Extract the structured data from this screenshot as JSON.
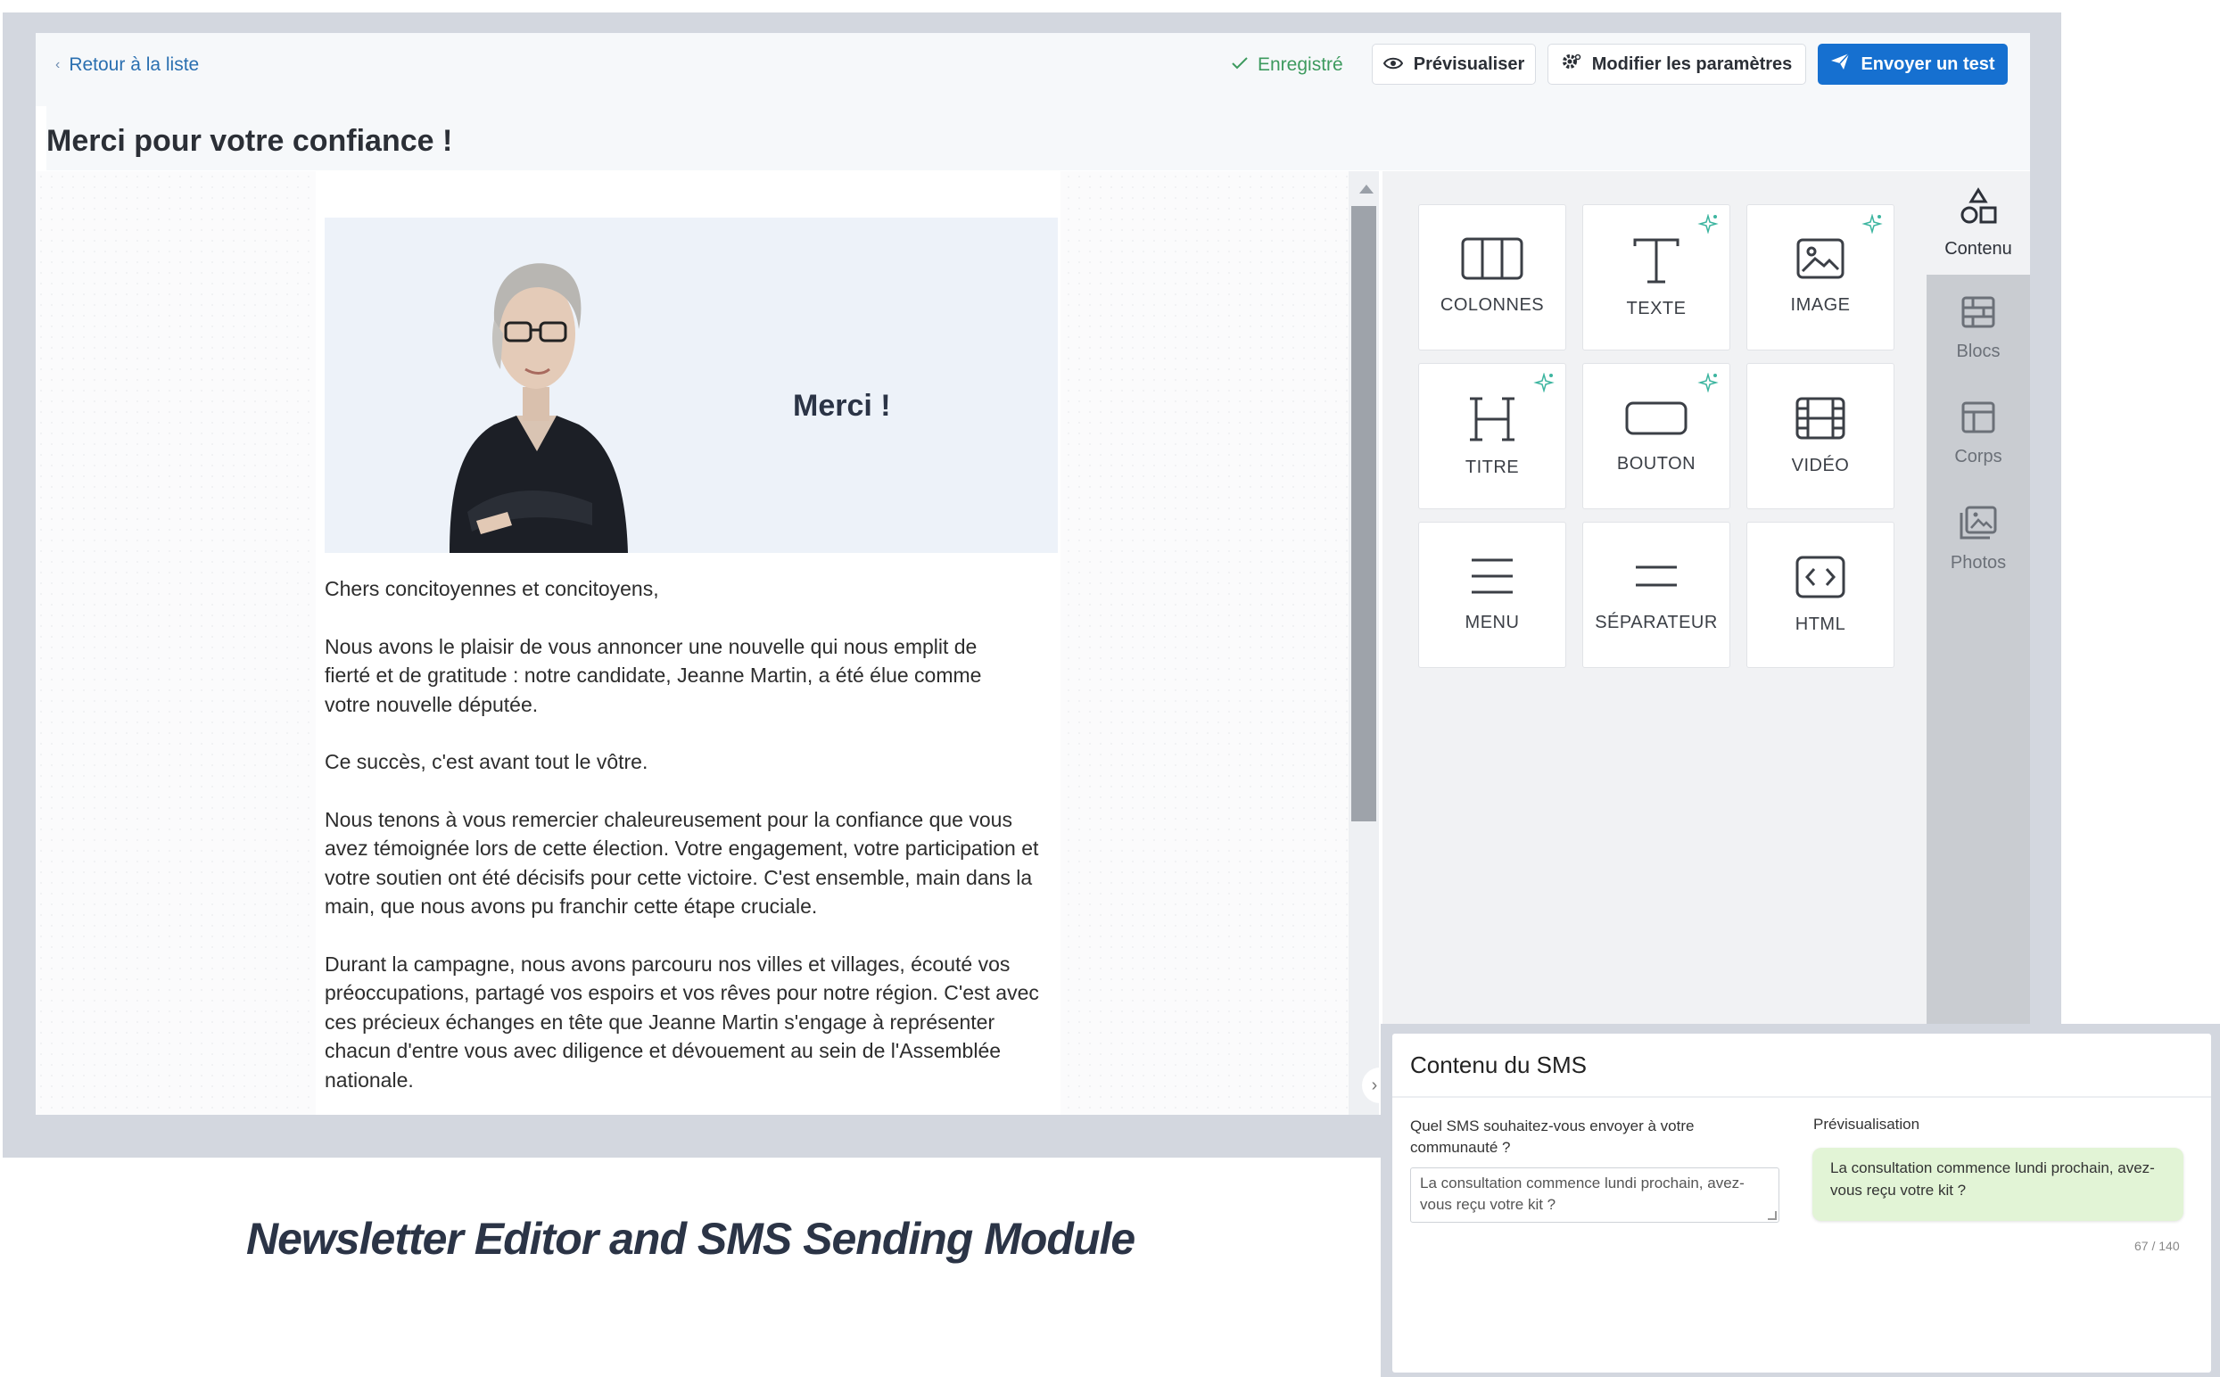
{
  "header": {
    "back_label": "Retour à la liste",
    "saved_label": "Enregistré",
    "preview_label": "Prévisualiser",
    "params_label": "Modifier les paramètres",
    "send_label": "Envoyer un test",
    "title": "Merci pour votre confiance !"
  },
  "email": {
    "hero_title": "Merci !",
    "paragraphs": [
      "Chers concitoyennes et concitoyens,",
      "Nous avons le plaisir de vous annoncer une nouvelle qui nous emplit de fierté et de gratitude : notre candidate, Jeanne Martin, a été élue comme votre nouvelle députée.",
      "Ce succès, c'est avant tout le vôtre.",
      "Nous tenons à vous remercier chaleureusement pour la confiance que vous avez témoignée lors de cette élection. Votre engagement, votre participation et votre soutien ont été décisifs pour cette victoire. C'est ensemble, main dans la main, que nous avons pu franchir cette étape cruciale.",
      "Durant la campagne, nous avons parcouru nos villes et villages, écouté vos préoccupations, partagé vos espoirs et vos rêves pour notre région. C'est avec ces précieux échanges en tête que Jeanne Martin s'engage à représenter chacun d'entre vous avec diligence et dévouement au sein de l'Assemblée nationale."
    ]
  },
  "tools": {
    "tiles": [
      {
        "label": "COLONNES",
        "icon": "columns-icon",
        "ai": false
      },
      {
        "label": "TEXTE",
        "icon": "text-icon",
        "ai": true
      },
      {
        "label": "IMAGE",
        "icon": "image-icon",
        "ai": true
      },
      {
        "label": "TITRE",
        "icon": "heading-icon",
        "ai": true
      },
      {
        "label": "BOUTON",
        "icon": "button-icon",
        "ai": true
      },
      {
        "label": "VIDÉO",
        "icon": "video-icon",
        "ai": false
      },
      {
        "label": "MENU",
        "icon": "menu-icon",
        "ai": false
      },
      {
        "label": "SÉPARATEUR",
        "icon": "separator-icon",
        "ai": false
      },
      {
        "label": "HTML",
        "icon": "html-icon",
        "ai": false
      }
    ],
    "side_tabs": [
      {
        "label": "Contenu",
        "icon": "shapes-icon",
        "active": true
      },
      {
        "label": "Blocs",
        "icon": "blocks-icon",
        "active": false
      },
      {
        "label": "Corps",
        "icon": "layout-icon",
        "active": false
      },
      {
        "label": "Photos",
        "icon": "photos-icon",
        "active": false
      }
    ]
  },
  "sms": {
    "title": "Contenu du SMS",
    "question": "Quel SMS souhaitez-vous envoyer à votre communauté ?",
    "input_value": "La consultation commence lundi prochain, avez-vous reçu votre kit ?",
    "preview_label": "Prévisualisation",
    "preview_text": "La consultation commence lundi prochain, avez-vous reçu votre kit ?",
    "count": "67 / 140"
  },
  "caption": "Newsletter Editor and SMS Sending Module",
  "colors": {
    "accent": "#1670d0",
    "saved": "#3d9a5e",
    "frame": "#d3d7df",
    "sms_bubble": "#e2f4d6"
  }
}
